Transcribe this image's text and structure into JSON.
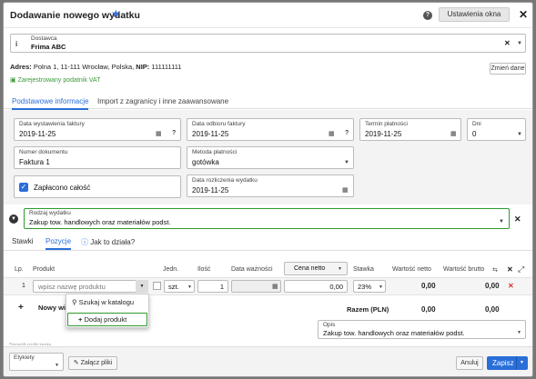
{
  "window": {
    "title": "Dodawanie nowego wydatku",
    "settings_button": "Ustawienia okna"
  },
  "supplier": {
    "label": "Dostawca",
    "value": "Frima ABC"
  },
  "address": {
    "prefix": "Adres:",
    "text": "Polna 1, 11-111 Wrocław, Polska,",
    "nip_label": "NIP:",
    "nip": "111111111",
    "vat_status": "Zarejestrowany podatnik VAT",
    "change_button": "Zmień dane"
  },
  "tabs": [
    {
      "label": "Podstawowe informacje"
    },
    {
      "label": "Import z zagranicy i inne zaawansowane"
    }
  ],
  "form": {
    "issue_date": {
      "label": "Data wystawienia faktury",
      "value": "2019-11-25"
    },
    "receipt_date": {
      "label": "Data odbioru faktury",
      "value": "2019-11-25"
    },
    "due_date": {
      "label": "Termin płatności",
      "value": "2019-11-25"
    },
    "days": {
      "label": "Dni",
      "value": "0"
    },
    "doc_number": {
      "label": "Numer dokumentu",
      "value": "Faktura 1"
    },
    "payment_method": {
      "label": "Metoda płatności",
      "value": "gotówka"
    },
    "paid_all": {
      "label": "Zapłacono całość",
      "checked": true
    },
    "settlement_date": {
      "label": "Data rozliczenia wydatku",
      "value": "2019-11-25"
    },
    "expense_type": {
      "label": "Rodzaj wydatku",
      "value": "Zakup tow. handlowych oraz materiałów podst."
    }
  },
  "subtabs": [
    {
      "label": "Stawki"
    },
    {
      "label": "Pozycje"
    },
    {
      "label": "Jak to działa?"
    }
  ],
  "table": {
    "headers": [
      "Lp.",
      "Produkt",
      "Jedn.",
      "Ilość",
      "Data ważności",
      "Cena netto",
      "Stawka",
      "Wartość netto",
      "Wartość brutto"
    ],
    "row": {
      "lp": "1",
      "product_placeholder": "wpisz nazwę produktu",
      "unit": "szt.",
      "qty": "1",
      "price": "0,00",
      "rate": "23%",
      "net": "0,00",
      "gross": "0,00"
    },
    "add_new": "Nowy wier",
    "total_label": "Razem (PLN)",
    "total_net": "0,00",
    "total_gross": "0,00"
  },
  "dropdown": {
    "search": "Szukaj w katalogu",
    "add": "Dodaj produkt"
  },
  "description": {
    "label": "Opis",
    "value": "Zakup tow. handlowych oraz materiałów podst."
  },
  "footer": {
    "partial_label": "Sposób rozliczenia",
    "tags_label": "Etykiety",
    "attach_button": "Załącz pliki",
    "cancel_button": "Anuluj",
    "save_button": "Zapisz"
  },
  "colors": {
    "accent": "#2a6ed8",
    "highlight": "#2e9a2e",
    "delete": "#d33"
  }
}
